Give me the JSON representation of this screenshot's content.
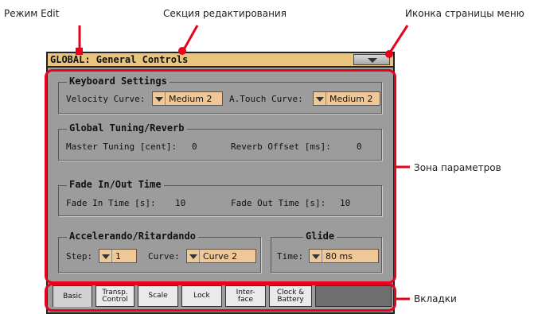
{
  "callouts": {
    "mode": "Режим Edit",
    "section": "Секция редактирования",
    "menu_icon": "Иконка страницы меню",
    "params": "Зона параметров",
    "tabs": "Вкладки"
  },
  "page": {
    "title": "GLOBAL: General Controls"
  },
  "groups": {
    "keyboard": {
      "title": "Keyboard Settings",
      "velocity_label": "Velocity Curve:",
      "velocity_value": "Medium 2",
      "atouch_label": "A.Touch Curve:",
      "atouch_value": "Medium 2"
    },
    "tuning": {
      "title": "Global Tuning/Reverb",
      "master_label": "Master Tuning [cent]:",
      "master_value": "0",
      "reverb_label": "Reverb Offset [ms]:",
      "reverb_value": "0"
    },
    "fade": {
      "title": "Fade In/Out Time",
      "in_label": "Fade In Time [s]:",
      "in_value": "10",
      "out_label": "Fade Out Time [s]:",
      "out_value": "10"
    },
    "accel": {
      "title": "Accelerando/Ritardando",
      "step_label": "Step:",
      "step_value": "1",
      "curve_label": "Curve:",
      "curve_value": "Curve 2"
    },
    "glide": {
      "title": "Glide",
      "time_label": "Time:",
      "time_value": "80 ms"
    }
  },
  "tabs": [
    {
      "label": "Basic"
    },
    {
      "label": "Transp.\nControl"
    },
    {
      "label": "Scale"
    },
    {
      "label": "Lock"
    },
    {
      "label": "Inter-\nface"
    },
    {
      "label": "Clock &\nBattery"
    }
  ],
  "colors": {
    "highlight": "#e8001c",
    "title_bar": "#e8c47c",
    "dropdown": "#f0c898",
    "panel": "#9c9c9c"
  }
}
